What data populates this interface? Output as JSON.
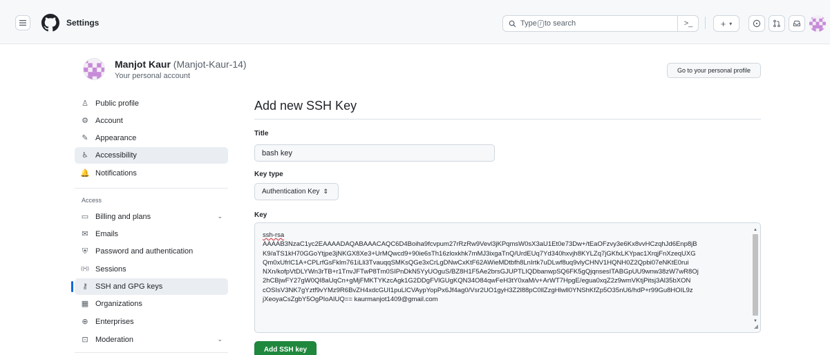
{
  "header": {
    "title": "Settings",
    "search_placeholder_pre": "Type",
    "search_slash": "/",
    "search_placeholder_post": "to search",
    "command_palette": ">_",
    "plus_label": "+",
    "plus_caret": "▾"
  },
  "profile": {
    "name": "Manjot Kaur",
    "login": "(Manjot-Kaur-14)",
    "subtitle": "Your personal account",
    "go_to_profile": "Go to your personal profile"
  },
  "sidebar": {
    "items": [
      {
        "label": "Public profile",
        "icon": "person-icon",
        "glyph": "♙"
      },
      {
        "label": "Account",
        "icon": "gear-icon",
        "glyph": "⚙"
      },
      {
        "label": "Appearance",
        "icon": "paintbrush-icon",
        "glyph": "✎"
      },
      {
        "label": "Accessibility",
        "icon": "accessibility-icon",
        "glyph": "♿"
      },
      {
        "label": "Notifications",
        "icon": "bell-icon",
        "glyph": "🔔"
      }
    ],
    "access_label": "Access",
    "access_items": [
      {
        "label": "Billing and plans",
        "icon": "credit-card-icon",
        "glyph": "▭",
        "chevron": "⌄"
      },
      {
        "label": "Emails",
        "icon": "mail-icon",
        "glyph": "✉"
      },
      {
        "label": "Password and authentication",
        "icon": "shield-lock-icon",
        "glyph": "⛨"
      },
      {
        "label": "Sessions",
        "icon": "broadcast-icon",
        "glyph": "((•))"
      },
      {
        "label": "SSH and GPG keys",
        "icon": "key-icon",
        "glyph": "⚷"
      },
      {
        "label": "Organizations",
        "icon": "organization-icon",
        "glyph": "▦"
      },
      {
        "label": "Enterprises",
        "icon": "globe-icon",
        "glyph": "⊕"
      },
      {
        "label": "Moderation",
        "icon": "report-icon",
        "glyph": "⊡",
        "chevron": "⌄"
      }
    ]
  },
  "form": {
    "heading": "Add new SSH Key",
    "title_label": "Title",
    "title_value": "bash key",
    "key_type_label": "Key type",
    "key_type_value": "Authentication Key",
    "key_type_caret": "⇕",
    "key_label": "Key",
    "key_prefix": "ssh-rsa",
    "key_lines": [
      "AAAAB3NzaC1yc2EAAAADAQABAAACAQC6D4Boiha9fcvpum27rRzRw9Vevl3jKPqmsW0sX3aU1Et0e73Dw+/tEaOFzvy3e6Kx8vvHCzqhJd6Enp8jB",
      "K9/aTS1kH70GGoYtjpe3jNKGX8Xe3+UrMQwcd9+90ie6sTh16zloxkhk7mMJ3ixgaTnQ/UrdEUq7Yd340hxvjh8KYLZq7jGKfxLKYpac1XrqjFnXzeqUXG",
      "Qm0xUfrlC1A+CPLrfGsFklm761iLli3TvauqqSMKsQGe3xCrLgDNwCxKtF62AWieMDtbfh8LnIrtk7uDLwf8uq9vlyCHNV1HQNH0Z2Qpbi07eNKtE0rui",
      "NXn/kofpVtDLYWn3rTB+r1TnvJFTwP8Tm0SIPnDkN5YyUOguS/BZ8H1F5Ae2brsGJUPTLIQDbanwpSQ6FK5gQjqnsesITABGpUU9wnw38zW7wR8Oj",
      "2hCBjwFY27gW0QI8aUqCn+gMjFMKTYKzcAgk1G2DDgFVlGUgKQN34O84qwFeH3tY0xaM/v+ArWT7HpgE/egua0xqZ2z9wmVKtjPitsj3Al35bXON",
      "cOSIsV3NK7gYztf9vYMz9R6BvZH4xdcGUI1puLlCVAypYopPx6Jf4ag0/Vsr2UO1gyH3Z2l88pC0llZzgHlwll0YNShKfZp5O35nU6/hdP+r99Gu8HOIL9z",
      "jXeoyaCsZgbY5OgPIoAIUQ== kaurmanjot1409@gmail.com"
    ],
    "submit": "Add SSH key"
  }
}
